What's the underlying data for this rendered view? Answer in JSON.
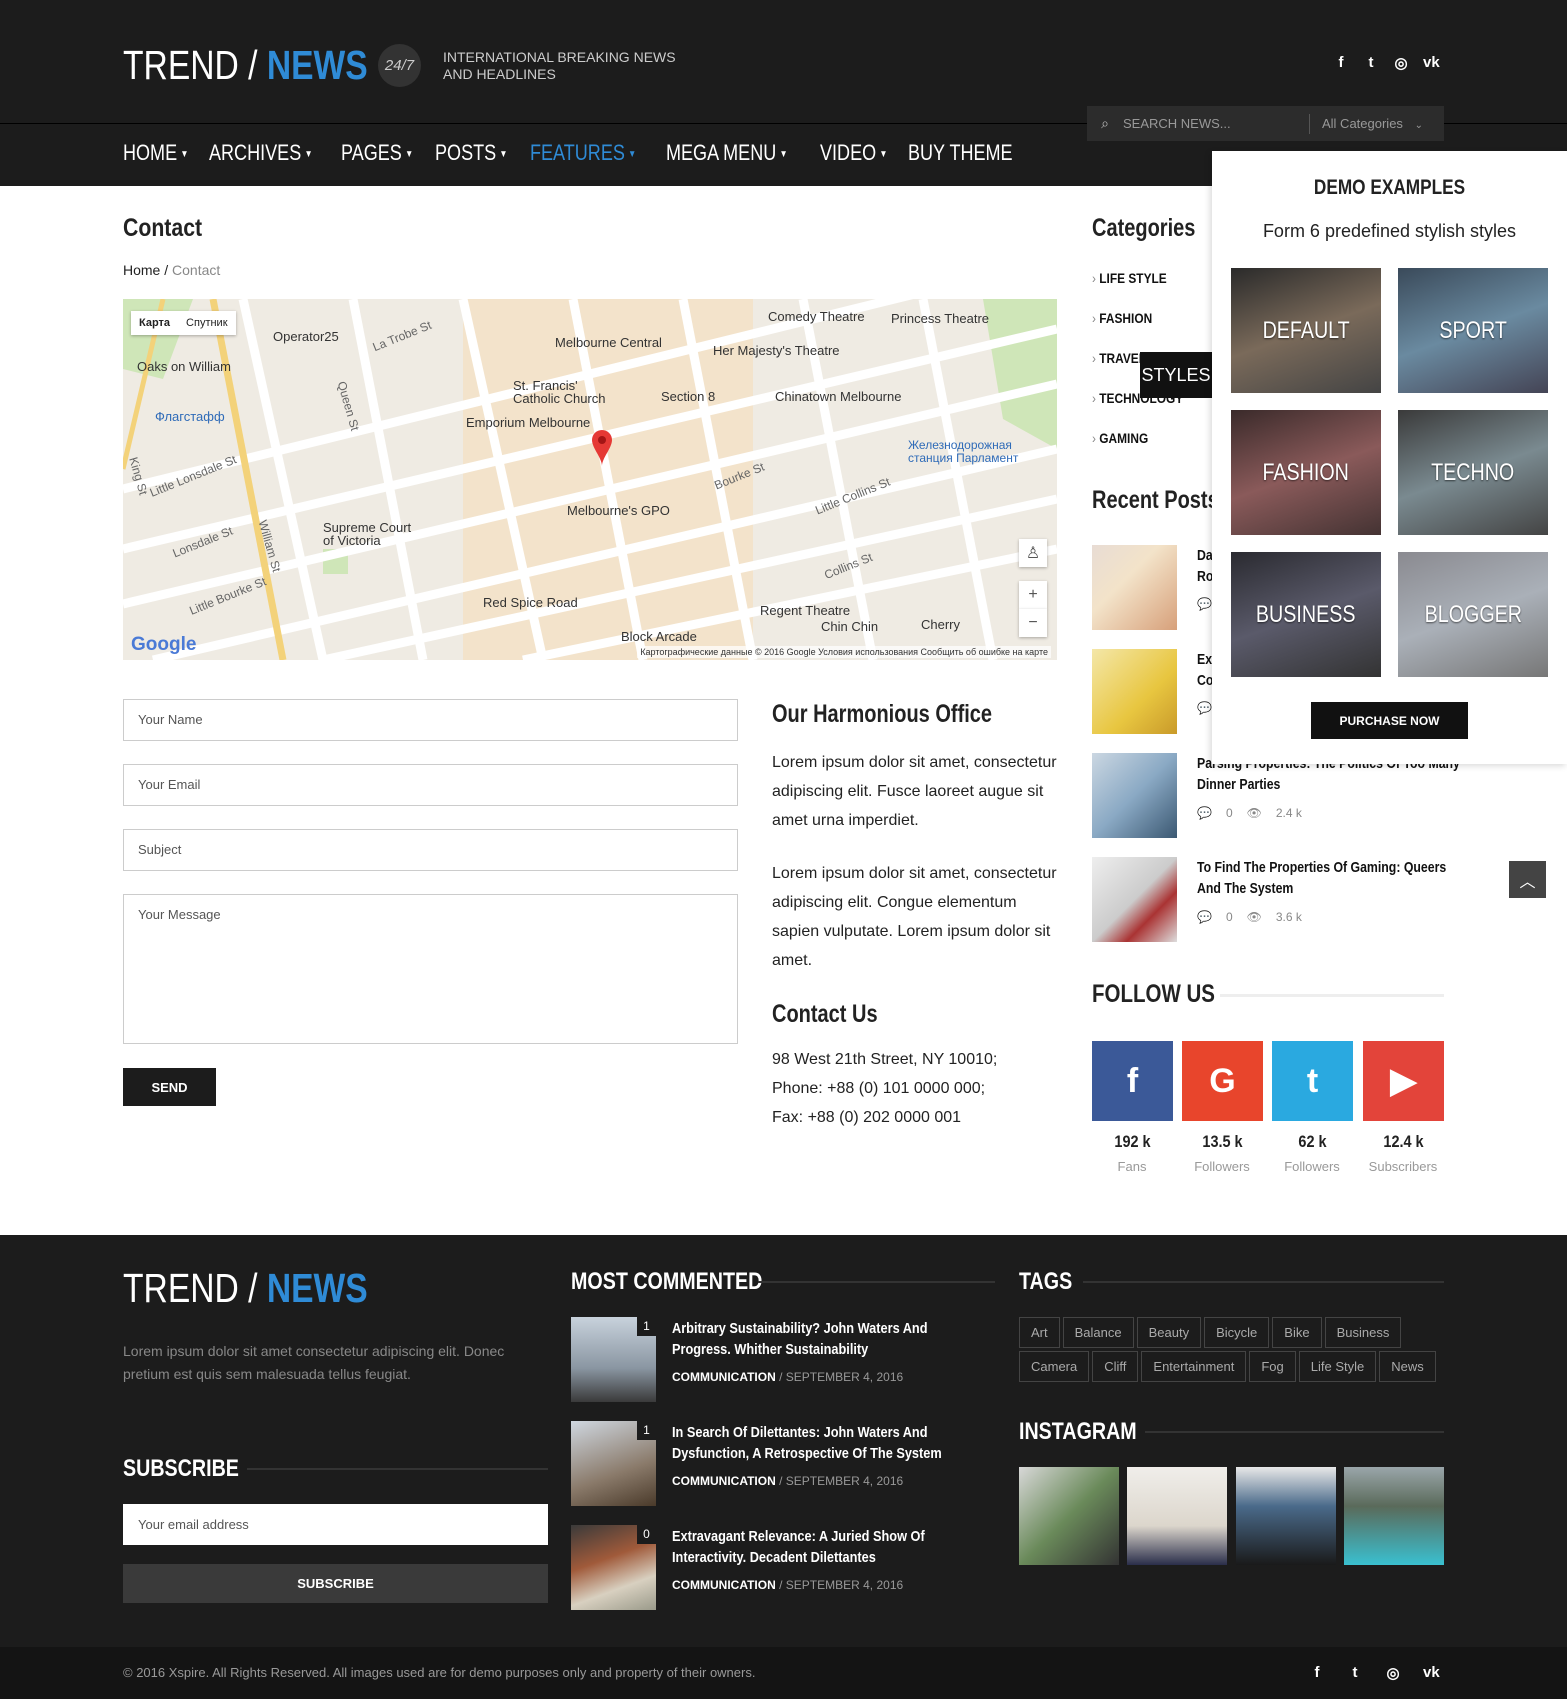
{
  "header": {
    "logo_left": "TREND / ",
    "logo_right": "NEWS",
    "badge": "24/7",
    "tagline_1": "INTERNATIONAL BREAKING NEWS",
    "tagline_2": "AND HEADLINES",
    "social": [
      "f",
      "t",
      "◎",
      "vk"
    ],
    "search_placeholder": "SEARCH NEWS...",
    "search_category": "All Categories"
  },
  "nav": [
    {
      "label": "HOME",
      "caret": true
    },
    {
      "label": "ARCHIVES",
      "caret": true
    },
    {
      "label": "PAGES",
      "caret": true
    },
    {
      "label": "POSTS",
      "caret": true
    },
    {
      "label": "FEATURES",
      "caret": true,
      "active": true
    },
    {
      "label": "MEGA MENU",
      "caret": true
    },
    {
      "label": "VIDEO",
      "caret": true
    },
    {
      "label": "BUY THEME",
      "caret": false
    }
  ],
  "page": {
    "title": "Contact",
    "breadcrumb_home": "Home",
    "breadcrumb_sep": "/",
    "breadcrumb_current": "Contact"
  },
  "map": {
    "tab_map": "Карта",
    "tab_sat": "Спутник",
    "google": "Google",
    "footer": "Картографические данные © 2016 Google   Условия использования   Сообщить об ошибке на карте",
    "places": {
      "operator25": "Operator25",
      "melbourne_central": "Melbourne Central",
      "comedy": "Comedy Theatre",
      "princess": "Princess Theatre",
      "majesty": "Her Majesty's Theatre",
      "oaks": "Oaks on William",
      "st_francis": "St. Francis' Catholic Church",
      "section8": "Section 8",
      "chinatown": "Chinatown Melbourne",
      "flagstaff": "Флагстафф",
      "emporium": "Emporium Melbourne",
      "parliament": "Железнодорожная станция Парламент",
      "gpo": "Melbourne's GPO",
      "supreme": "Supreme Court of Victoria",
      "red_spice": "Red Spice Road",
      "regent": "Regent Theatre",
      "chinchin": "Chin Chin",
      "cherry": "Cherry",
      "block": "Block Arcade"
    },
    "streets": {
      "la_trobe": "La Trobe St",
      "little_lonsdale": "Little Lonsdale St",
      "lonsdale": "Lonsdale St",
      "little_bourke": "Little Bourke St",
      "bourke": "Bourke St",
      "little_collins": "Little Collins St",
      "collins": "Collins St",
      "william": "William St",
      "queen": "Queen St",
      "king": "King St"
    }
  },
  "form": {
    "name_placeholder": "Your Name",
    "email_placeholder": "Your Email",
    "subject_placeholder": "Subject",
    "message_placeholder": "Your Message",
    "send_label": "SEND"
  },
  "office": {
    "title": "Our Harmonious Office",
    "p1": "Lorem ipsum dolor sit amet, consectetur adipiscing elit. Fusce laoreet augue sit amet urna imperdiet.",
    "p2": "Lorem ipsum dolor sit amet, consectetur adipiscing elit. Congue elementum sapien vulputate. Lorem ipsum dolor sit amet.",
    "contact_title": "Contact Us",
    "address": "98 West 21th Street, NY 10010;",
    "phone": "Phone: +88 (0) 101 0000 000;",
    "fax": "Fax: +88 (0) 202 0000 001"
  },
  "sidebar": {
    "categories_title": "Categories",
    "categories": [
      "LIFE STYLE",
      "FASHION",
      "TRAVEL",
      "TECHNOLOGY",
      "GAMING"
    ],
    "recent_title": "Recent Posts",
    "posts": [
      {
        "title_1": "Da",
        "title_2": "Ro"
      },
      {
        "title_1": "Ext",
        "title_2": "Co"
      },
      {
        "title_1": "Parsing Properties: The Politics Of Too Many",
        "title_2": "Dinner Parties",
        "comments": "0",
        "views": "2.4 k"
      },
      {
        "title_1": "To Find The Properties Of Gaming: Queers",
        "title_2": "And The System",
        "comments": "0",
        "views": "3.6 k"
      }
    ],
    "follow_title": "FOLLOW US",
    "social": [
      {
        "icon": "f",
        "count": "192 k",
        "label": "Fans",
        "color": "#3b5998"
      },
      {
        "icon": "G",
        "count": "13.5 k",
        "label": "Followers",
        "color": "#e8452c"
      },
      {
        "icon": "t",
        "count": "62 k",
        "label": "Followers",
        "color": "#2aa9e0"
      },
      {
        "icon": "▶",
        "count": "12.4 k",
        "label": "Subscribers",
        "color": "#e3443a"
      }
    ]
  },
  "demo": {
    "title": "DEMO EXAMPLES",
    "subtitle": "Form 6 predefined stylish styles",
    "styles": [
      "DEFAULT",
      "SPORT",
      "FASHION",
      "TECHNO",
      "BUSINESS",
      "BLOGGER"
    ],
    "purchase": "PURCHASE NOW",
    "styles_button": "STYLES"
  },
  "footer": {
    "logo_left": "TREND / ",
    "logo_right": "NEWS",
    "desc": "Lorem ipsum dolor sit amet consectetur adipiscing elit. Donec pretium est quis sem malesuada tellus feugiat.",
    "subscribe_title": "SUBSCRIBE",
    "email_placeholder": "Your email address",
    "subscribe_button": "SUBSCRIBE",
    "most_commented_title": "MOST COMMENTED",
    "most_commented": [
      {
        "count": "1",
        "title": "Arbitrary Sustainability? John Waters And Progress. Whither Sustainability",
        "category": "COMMUNICATION",
        "date": "SEPTEMBER 4, 2016"
      },
      {
        "count": "1",
        "title": "In Search Of Dilettantes: John Waters And Dysfunction, A Retrospective Of The System",
        "category": "COMMUNICATION",
        "date": "SEPTEMBER 4, 2016"
      },
      {
        "count": "0",
        "title": "Extravagant Relevance: A Juried Show Of Interactivity. Decadent Dilettantes",
        "category": "COMMUNICATION",
        "date": "SEPTEMBER 4, 2016"
      }
    ],
    "tags_title": "TAGS",
    "tags": [
      "Art",
      "Balance",
      "Beauty",
      "Bicycle",
      "Bike",
      "Business",
      "Camera",
      "Cliff",
      "Entertainment",
      "Fog",
      "Life Style",
      "News"
    ],
    "instagram_title": "INSTAGRAM",
    "copyright": "© 2016 Xspire. All Rights Reserved. All images used are for demo purposes only and property of their owners.",
    "social": [
      "f",
      "t",
      "◎",
      "vk"
    ]
  }
}
